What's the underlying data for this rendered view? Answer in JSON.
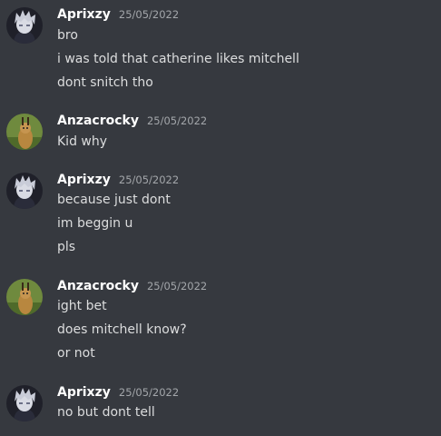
{
  "messages": [
    {
      "author": "Aprixzy",
      "avatar": "aprixzy-avatar",
      "timestamp": "25/05/2022",
      "lines": [
        "bro",
        "i was told that catherine likes mitchell",
        "dont snitch tho"
      ]
    },
    {
      "author": "Anzacrocky",
      "avatar": "anzacrocky-avatar",
      "timestamp": "25/05/2022",
      "lines": [
        "Kid why"
      ]
    },
    {
      "author": "Aprixzy",
      "avatar": "aprixzy-avatar",
      "timestamp": "25/05/2022",
      "lines": [
        "because just dont",
        "im beggin u",
        "pls"
      ]
    },
    {
      "author": "Anzacrocky",
      "avatar": "anzacrocky-avatar",
      "timestamp": "25/05/2022",
      "lines": [
        "ight bet",
        "does mitchell know?",
        "or not"
      ]
    },
    {
      "author": "Aprixzy",
      "avatar": "aprixzy-avatar",
      "timestamp": "25/05/2022",
      "lines": [
        "no but dont tell"
      ]
    }
  ],
  "colors": {
    "background": "#36393f",
    "username": "#ffffff",
    "timestamp": "#a3a6aa",
    "message_text": "#dcddde"
  }
}
